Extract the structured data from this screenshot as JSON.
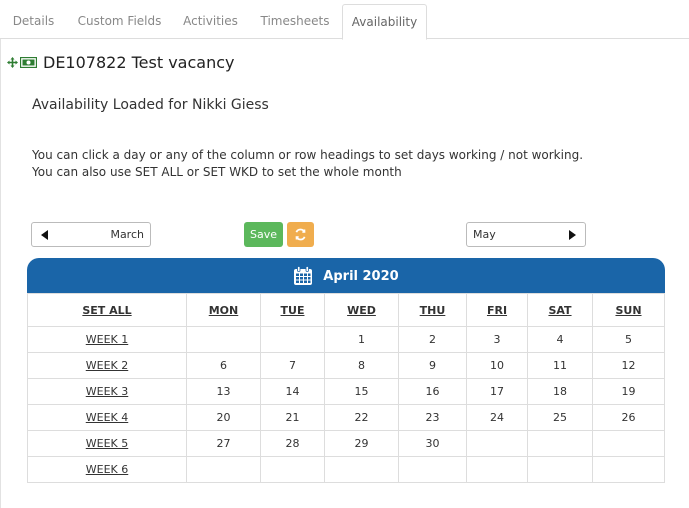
{
  "tabs": [
    {
      "label": "Details",
      "active": false
    },
    {
      "label": "Custom Fields",
      "active": false
    },
    {
      "label": "Activities",
      "active": false
    },
    {
      "label": "Timesheets",
      "active": false
    },
    {
      "label": "Availability",
      "active": true
    }
  ],
  "header": {
    "title": "DE107822 Test vacancy",
    "icons": [
      "move-icon",
      "cash-icon"
    ]
  },
  "loaded_text": "Availability Loaded for Nikki Giess",
  "help": {
    "line1": "You can click a day or any of the column or row headings to set days working / not working.",
    "line2": "You can also use SET ALL or SET WKD to set the whole month"
  },
  "nav": {
    "prev_label": "March",
    "next_label": "May",
    "save_label": "Save"
  },
  "calendar": {
    "title": "April 2020",
    "set_all": "SET ALL",
    "days": [
      "MON",
      "TUE",
      "WED",
      "THU",
      "FRI",
      "SAT",
      "SUN"
    ],
    "weeks": [
      {
        "label": "WEEK 1",
        "days": [
          "",
          "",
          "1",
          "2",
          "3",
          "4",
          "5"
        ]
      },
      {
        "label": "WEEK 2",
        "days": [
          "6",
          "7",
          "8",
          "9",
          "10",
          "11",
          "12"
        ]
      },
      {
        "label": "WEEK 3",
        "days": [
          "13",
          "14",
          "15",
          "16",
          "17",
          "18",
          "19"
        ]
      },
      {
        "label": "WEEK 4",
        "days": [
          "20",
          "21",
          "22",
          "23",
          "24",
          "25",
          "26"
        ]
      },
      {
        "label": "WEEK 5",
        "days": [
          "27",
          "28",
          "29",
          "30",
          "",
          "",
          ""
        ]
      },
      {
        "label": "WEEK 6",
        "days": [
          "",
          "",
          "",
          "",
          "",
          "",
          ""
        ]
      }
    ]
  },
  "colors": {
    "header_blue": "#1a65a8",
    "save_green": "#5cb85c",
    "refresh_orange": "#f0ad4e",
    "icon_green": "#2e7d32"
  }
}
